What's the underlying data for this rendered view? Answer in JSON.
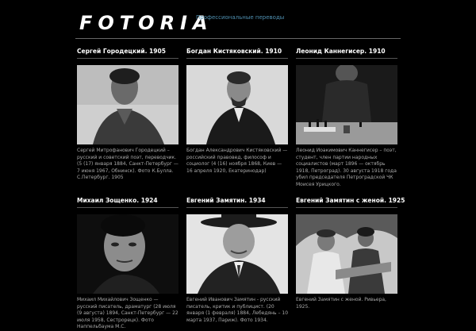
{
  "header": {
    "logo": "FOTORIA",
    "tagline": "Профессиональные переводы"
  },
  "cards": [
    {
      "title": "Сергей Городецкий. 1905",
      "caption": "Сергей Митрофанович Городецкий – русский и советский поэт, переводчик. (5 (17) января 1884, Санкт-Петербург — 7 июня 1967, Обнинск). Фото К.Булла. С.Петербург. 1905"
    },
    {
      "title": "Богдан Кистяковский. 1910",
      "caption": "Богдан Александрович Кистяковский — российский правовед, философ и социолог (4 (16) ноября 1868, Киев — 16 апреля 1920, Екатеринодар)"
    },
    {
      "title": "Леонид Каннегисер. 1910",
      "caption": "Леонид Иоакимович Каннегисер – поэт, студент, член партии народных социалистов (март 1896 — октябрь 1918, Петроград). 30 августа 1918 года убил председателя Петроградской ЧК Моисея Урицкого."
    },
    {
      "title": "Михаил Зощенко. 1924",
      "caption": "Михаил Михайлович Зощенко — русский писатель, драматург (28 июля (9 августа) 1894, Санкт-Петербург — 22 июля 1958, Сестрорецк). Фото Наппельбаума М.С."
    },
    {
      "title": "Евгений Замятин. 1934",
      "caption": "Евгений Иванович Замятин - русский писатель, критик и публицист. (20 января (1 февраля) 1884, Лебедянь – 10 марта 1937, Париж). Фото 1934."
    },
    {
      "title": "Евгений Замятин с женой. 1925",
      "caption": "Евгений Замятин с женой. Ривьера, 1925."
    }
  ]
}
